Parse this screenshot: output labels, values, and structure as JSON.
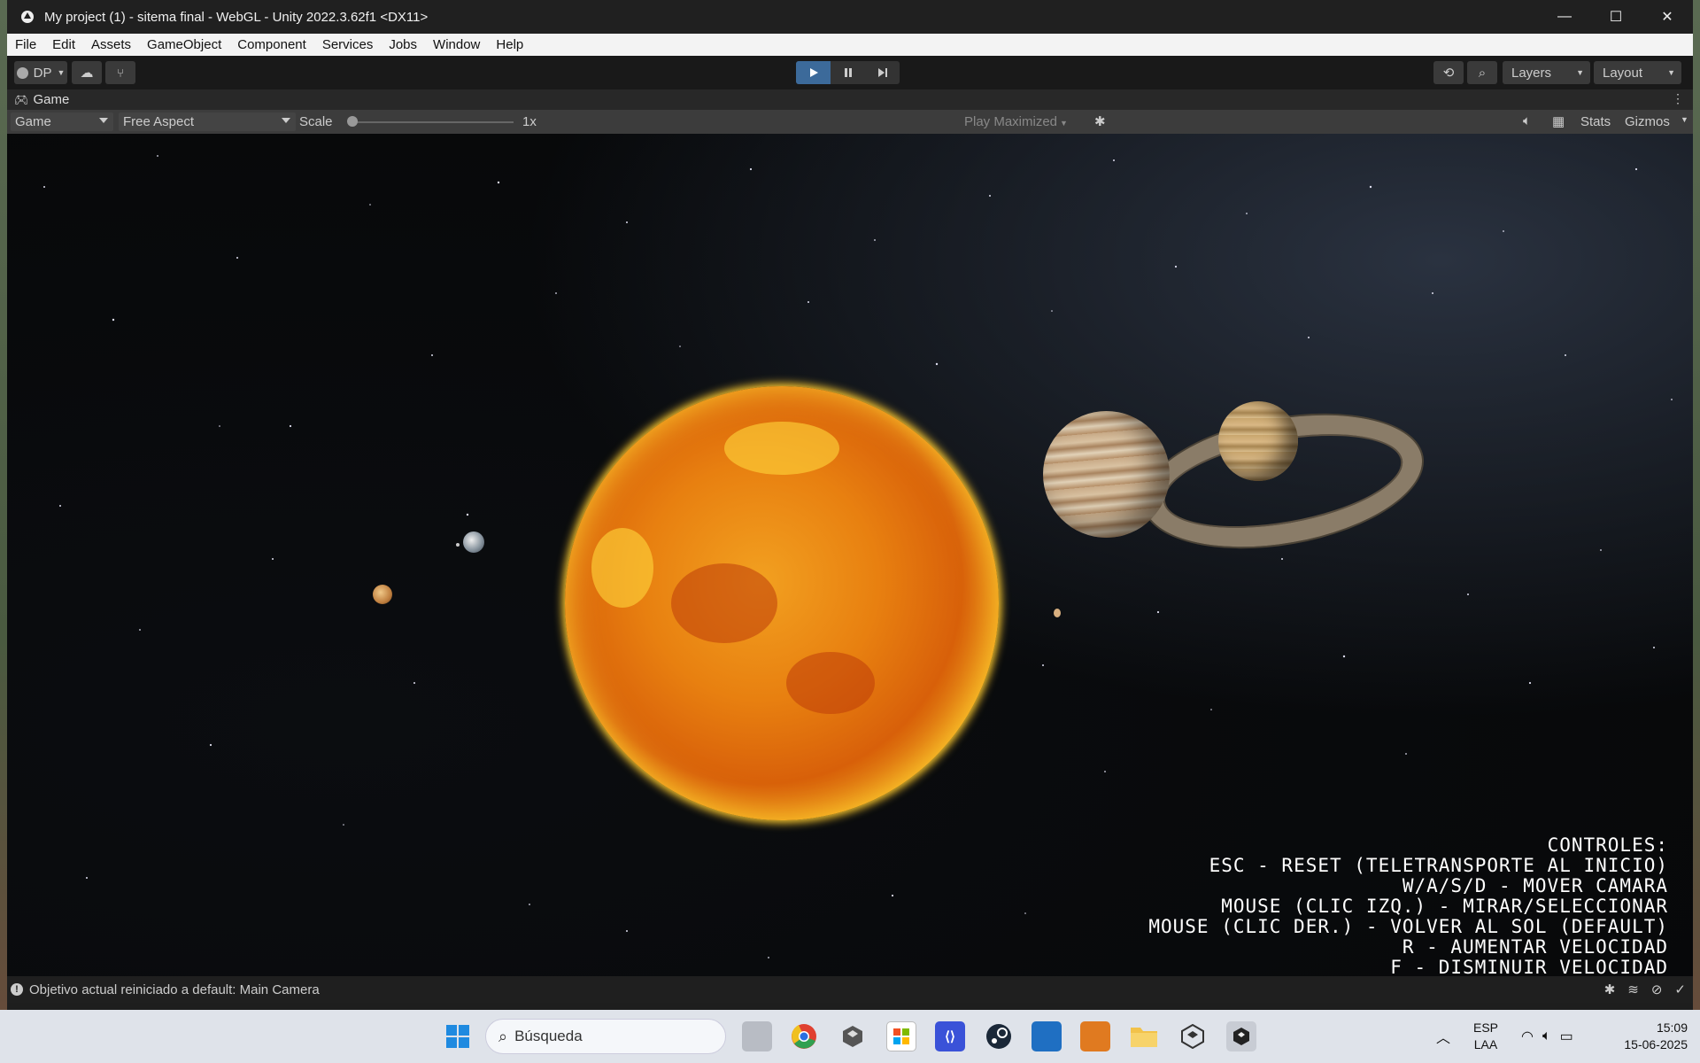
{
  "window": {
    "title": "My project (1) - sitema final - WebGL - Unity 2022.3.62f1 <DX11>",
    "minimize": "—",
    "maximize": "☐",
    "close": "✕"
  },
  "menu": [
    "File",
    "Edit",
    "Assets",
    "GameObject",
    "Component",
    "Services",
    "Jobs",
    "Window",
    "Help"
  ],
  "toolbar": {
    "account_label": "DP",
    "layers_label": "Layers",
    "layout_label": "Layout"
  },
  "tab": {
    "label": "Game"
  },
  "gamebar": {
    "display_dropdown": "Game",
    "aspect_dropdown": "Free Aspect",
    "scale_label": "Scale",
    "scale_value": "1x",
    "play_mode_dropdown": "Play Maximized",
    "stats_button": "Stats",
    "gizmos_button": "Gizmos"
  },
  "controls_overlay": [
    "CONTROLES:",
    "ESC - RESET (TELETRANSPORTE AL INICIO)",
    "W/A/S/D - MOVER CAMARA",
    "MOUSE (CLIC IZQ.) - MIRAR/SELECCIONAR",
    "MOUSE (CLIC DER.) - VOLVER AL SOL (DEFAULT)",
    "R - AUMENTAR VELOCIDAD",
    "F - DISMINUIR VELOCIDAD"
  ],
  "status": {
    "message": "Objetivo actual reiniciado a default: Main Camera"
  },
  "taskbar": {
    "search_placeholder": "Búsqueda",
    "lang_top": "ESP",
    "lang_bottom": "LAA",
    "time": "15:09",
    "date": "15-06-2025"
  },
  "colors": {
    "play_active": "#3c6a9a",
    "editor_bg": "#191919",
    "taskbar_bg": "#dfe3ea"
  }
}
